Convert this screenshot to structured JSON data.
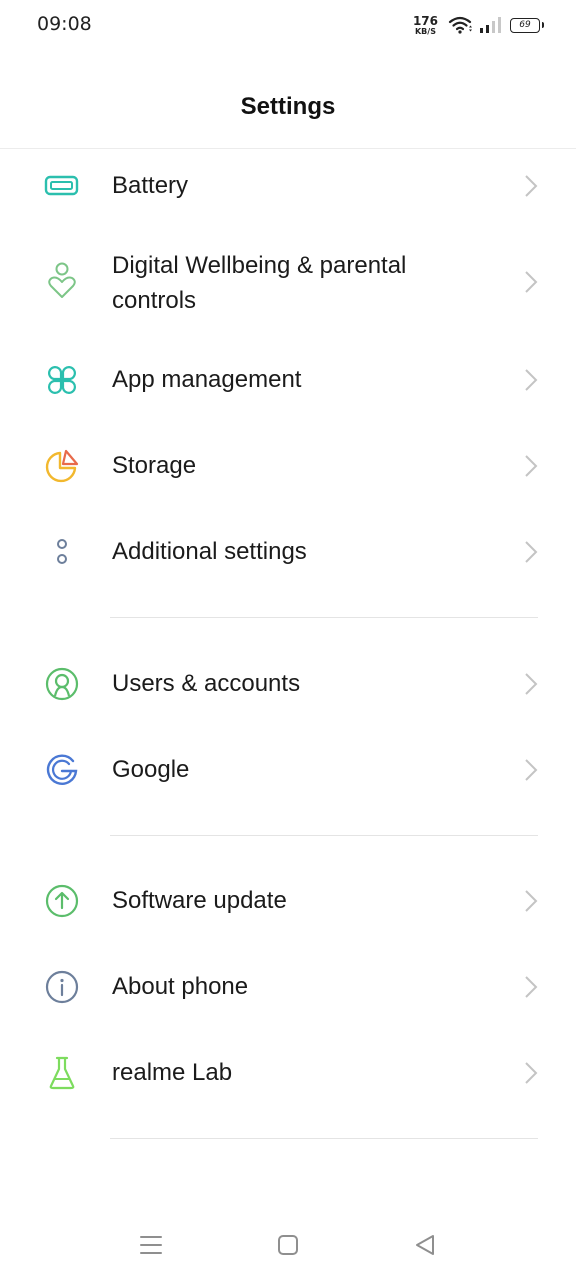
{
  "status_bar": {
    "time": "09:08",
    "net_speed_value": "176",
    "net_speed_unit": "KB/S",
    "battery_level": "69"
  },
  "header": {
    "title": "Settings"
  },
  "groups": [
    {
      "items": [
        {
          "label": "Battery",
          "icon": "battery-icon",
          "icon_color": "#2bbfae"
        },
        {
          "label": "Digital Wellbeing & parental controls",
          "icon": "wellbeing-icon",
          "icon_color": "#7cc587"
        },
        {
          "label": "App management",
          "icon": "app-management-icon",
          "icon_color": "#2bbfae"
        },
        {
          "label": "Storage",
          "icon": "storage-icon",
          "icon_color": "#f2b82e"
        },
        {
          "label": "Additional settings",
          "icon": "more-icon",
          "icon_color": "#6d7f9b"
        }
      ]
    },
    {
      "items": [
        {
          "label": "Users & accounts",
          "icon": "user-icon",
          "icon_color": "#5bbd6b"
        },
        {
          "label": "Google",
          "icon": "google-icon",
          "icon_color": "#4a78d4"
        }
      ]
    },
    {
      "items": [
        {
          "label": "Software update",
          "icon": "update-icon",
          "icon_color": "#5bbd6b"
        },
        {
          "label": "About phone",
          "icon": "info-icon",
          "icon_color": "#6d7f9b"
        },
        {
          "label": "realme Lab",
          "icon": "lab-icon",
          "icon_color": "#7ddc5e"
        }
      ]
    }
  ],
  "colors": {
    "chevron": "#c4c4c4",
    "divider": "#e4e4e4",
    "text": "#1b1b1b"
  },
  "nav_bar": {
    "buttons": [
      "menu-icon",
      "home-icon",
      "back-icon"
    ]
  }
}
